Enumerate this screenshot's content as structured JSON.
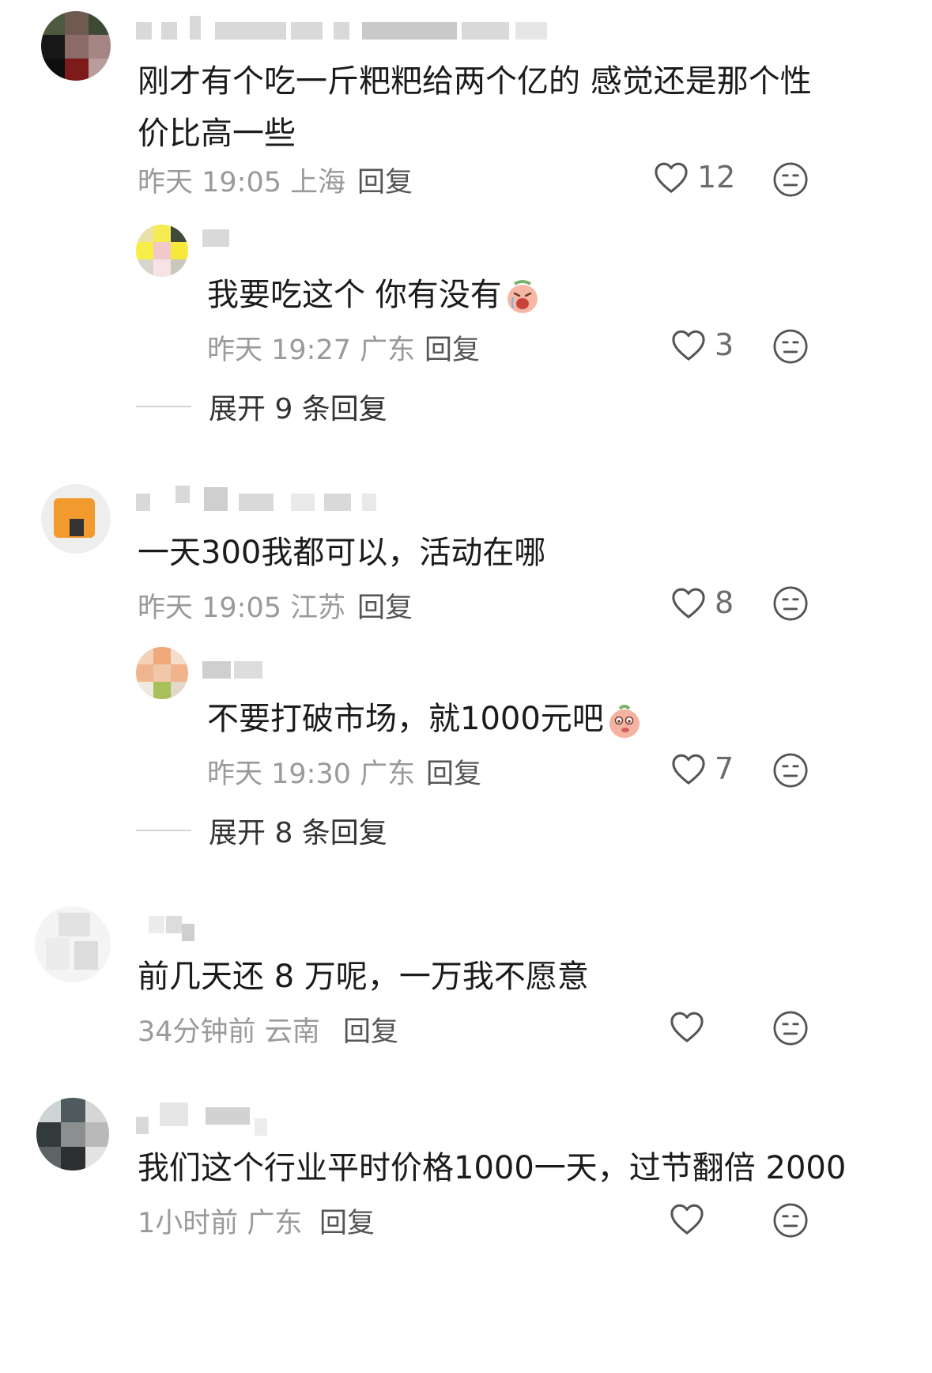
{
  "comments": [
    {
      "text": "刚才有个吃一斤粑粑给两个亿的 感觉还是那个性价比高一些",
      "time": "昨天 19:05",
      "location": "上海",
      "reply_label": "回复",
      "likes": "12",
      "replies": [
        {
          "text": "我要吃这个 你有没有",
          "time": "昨天 19:27",
          "location": "广东",
          "reply_label": "回复",
          "likes": "3"
        }
      ],
      "expand_label": "展开 9 条回复"
    },
    {
      "text": "一天300我都可以，活动在哪",
      "time": "昨天 19:05",
      "location": "江苏",
      "reply_label": "回复",
      "likes": "8",
      "replies": [
        {
          "text": "不要打破市场，就1000元吧",
          "time": "昨天 19:30",
          "location": "广东",
          "reply_label": "回复",
          "likes": "7"
        }
      ],
      "expand_label": "展开 8 条回复"
    },
    {
      "text": "前几天还 8 万呢，一万我不愿意",
      "time": "34分钟前",
      "location": "云南",
      "reply_label": "回复",
      "likes": ""
    },
    {
      "text": "我们这个行业平时价格1000一天，过节翻倍 2000",
      "time": "1小时前",
      "location": "广东",
      "reply_label": "回复",
      "likes": ""
    }
  ],
  "icons": {
    "like": "heart-outline-icon",
    "dislike": "neutral-face-icon",
    "sticker_1": "crying-sticker-icon",
    "sticker_2": "shy-peach-sticker-icon"
  },
  "colors": {
    "meta": "#9a9a9a",
    "text": "#1b1b1b",
    "icon": "#555555"
  }
}
